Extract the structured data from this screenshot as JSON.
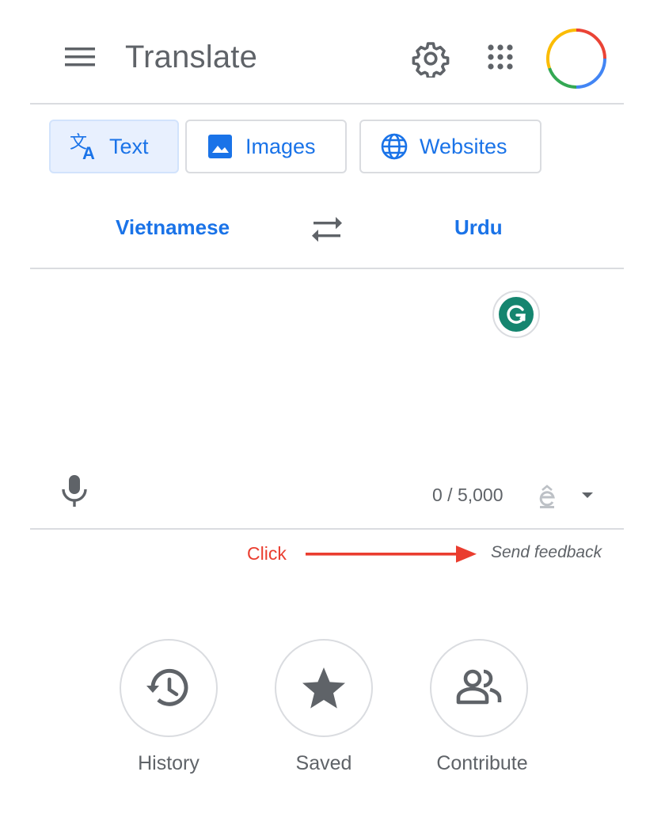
{
  "header": {
    "title": "Translate",
    "icons": {
      "menu": "menu-icon",
      "settings": "gear-icon",
      "apps": "apps-grid-icon",
      "account": "account-avatar"
    }
  },
  "tabs": [
    {
      "label": "Text",
      "icon": "translate-icon",
      "active": true
    },
    {
      "label": "Images",
      "icon": "image-icon",
      "active": false
    },
    {
      "label": "Websites",
      "icon": "globe-icon",
      "active": false
    }
  ],
  "languages": {
    "source": "Vietnamese",
    "target": "Urdu",
    "swap_icon": "swap-arrows-icon"
  },
  "input": {
    "char_count": "0 / 5,000",
    "grammarly_icon": "grammarly-icon",
    "mic_icon": "mic-icon",
    "input_tool_icon": "input-tool-icon",
    "dropdown_icon": "caret-down-icon"
  },
  "annotation": {
    "click_label": "Click",
    "arrow_color": "#ea3d2f"
  },
  "feedback": {
    "label": "Send feedback"
  },
  "actions": [
    {
      "label": "History",
      "icon": "history-icon"
    },
    {
      "label": "Saved",
      "icon": "star-icon"
    },
    {
      "label": "Contribute",
      "icon": "people-icon"
    }
  ],
  "colors": {
    "accent": "#1a73e8",
    "text": "#5f6368",
    "divider": "#dadce0",
    "active_tab_bg": "#e8f0fe",
    "grammarly": "#15856f"
  }
}
